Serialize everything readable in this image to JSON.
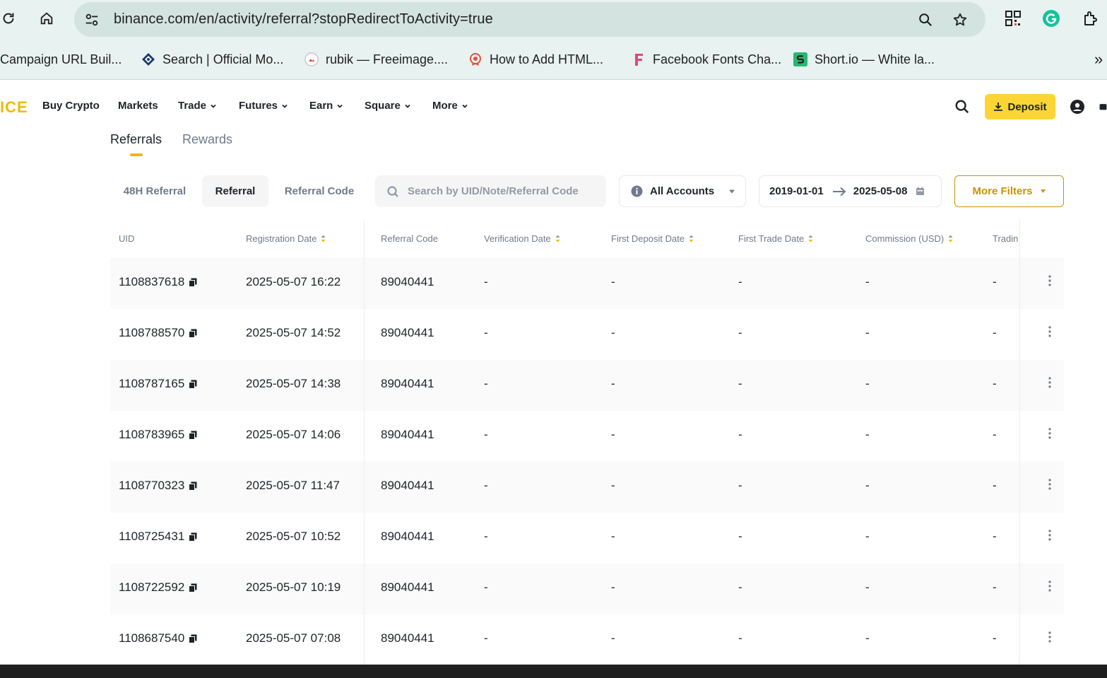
{
  "browser": {
    "url": "binance.com/en/activity/referral?stopRedirectToActivity=true",
    "bookmarks": [
      {
        "label": "Campaign URL Buil...",
        "icon": "none"
      },
      {
        "label": "Search | Official Mo...",
        "icon": "diamond-icon"
      },
      {
        "label": "rubik — Freeimage....",
        "icon": "image-host-icon"
      },
      {
        "label": "How to Add HTML...",
        "icon": "badge-icon"
      },
      {
        "label": "Facebook Fonts Cha...",
        "icon": "f-letter-icon"
      },
      {
        "label": "Short.io — White la...",
        "icon": "s-logo-icon"
      }
    ],
    "more_bookmarks": "»"
  },
  "header": {
    "logo": "ICE",
    "nav": [
      {
        "label": "Buy Crypto",
        "dropdown": false
      },
      {
        "label": "Markets",
        "dropdown": false
      },
      {
        "label": "Trade",
        "dropdown": true
      },
      {
        "label": "Futures",
        "dropdown": true
      },
      {
        "label": "Earn",
        "dropdown": true
      },
      {
        "label": "Square",
        "dropdown": true
      },
      {
        "label": "More",
        "dropdown": true
      }
    ],
    "deposit_label": "Deposit",
    "accent": "#fcd535"
  },
  "page_tabs": [
    {
      "label": "Referrals",
      "active": true
    },
    {
      "label": "Rewards",
      "active": false
    }
  ],
  "filters": {
    "segments": [
      {
        "label": "48H Referral",
        "active": false
      },
      {
        "label": "Referral",
        "active": true
      },
      {
        "label": "Referral Code",
        "active": false
      }
    ],
    "search_placeholder": "Search by UID/Note/Referral Code",
    "account_select": "All Accounts",
    "date_from": "2019-01-01",
    "date_to": "2025-05-08",
    "more_filters": "More Filters"
  },
  "table": {
    "columns": [
      "UID",
      "Registration Date",
      "Referral Code",
      "Verification Date",
      "First Deposit Date",
      "First Trade Date",
      "Commission (USD)",
      "Tradin"
    ],
    "sortable": [
      false,
      true,
      false,
      true,
      true,
      true,
      true,
      false
    ],
    "rows": [
      {
        "uid": "1108837618",
        "reg": "2025-05-07 16:22",
        "code": "89040441",
        "ver": "-",
        "dep": "-",
        "trade": "-",
        "comm": "-",
        "vol": "-"
      },
      {
        "uid": "1108788570",
        "reg": "2025-05-07 14:52",
        "code": "89040441",
        "ver": "-",
        "dep": "-",
        "trade": "-",
        "comm": "-",
        "vol": "-"
      },
      {
        "uid": "1108787165",
        "reg": "2025-05-07 14:38",
        "code": "89040441",
        "ver": "-",
        "dep": "-",
        "trade": "-",
        "comm": "-",
        "vol": "-"
      },
      {
        "uid": "1108783965",
        "reg": "2025-05-07 14:06",
        "code": "89040441",
        "ver": "-",
        "dep": "-",
        "trade": "-",
        "comm": "-",
        "vol": "-"
      },
      {
        "uid": "1108770323",
        "reg": "2025-05-07 11:47",
        "code": "89040441",
        "ver": "-",
        "dep": "-",
        "trade": "-",
        "comm": "-",
        "vol": "-"
      },
      {
        "uid": "1108725431",
        "reg": "2025-05-07 10:52",
        "code": "89040441",
        "ver": "-",
        "dep": "-",
        "trade": "-",
        "comm": "-",
        "vol": "-"
      },
      {
        "uid": "1108722592",
        "reg": "2025-05-07 10:19",
        "code": "89040441",
        "ver": "-",
        "dep": "-",
        "trade": "-",
        "comm": "-",
        "vol": "-"
      },
      {
        "uid": "1108687540",
        "reg": "2025-05-07 07:08",
        "code": "89040441",
        "ver": "-",
        "dep": "-",
        "trade": "-",
        "comm": "-",
        "vol": "-"
      }
    ]
  }
}
